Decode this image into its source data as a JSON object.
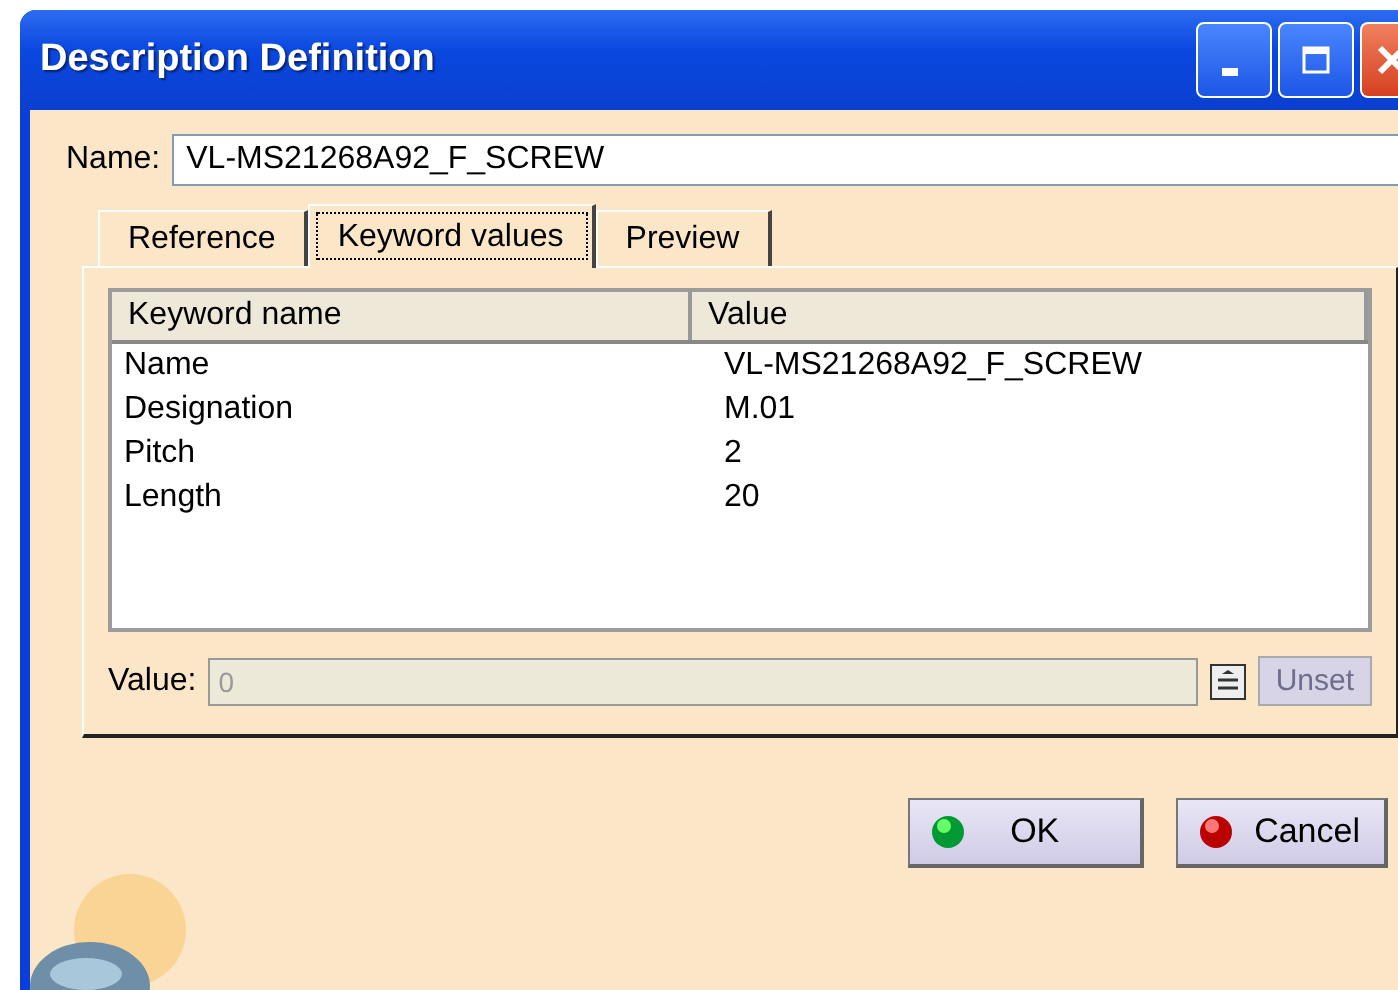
{
  "window": {
    "title": "Description Definition"
  },
  "name_field": {
    "label": "Name:",
    "value": "VL-MS21268A92_F_SCREW"
  },
  "tabs": [
    {
      "label": "Reference",
      "selected": false
    },
    {
      "label": "Keyword values",
      "selected": true
    },
    {
      "label": "Preview",
      "selected": false
    }
  ],
  "table": {
    "columns": [
      "Keyword name",
      "Value"
    ],
    "rows": [
      [
        "Name",
        "VL-MS21268A92_F_SCREW"
      ],
      [
        "Designation",
        "M.01"
      ],
      [
        "Pitch",
        "2"
      ],
      [
        "Length",
        "20"
      ]
    ]
  },
  "value_field": {
    "label": "Value:",
    "value": "0",
    "disabled": true
  },
  "unset_button": {
    "label": "Unset",
    "disabled": true
  },
  "buttons": [
    {
      "label": "OK",
      "kind": "ok"
    },
    {
      "label": "Cancel",
      "kind": "cancel"
    }
  ]
}
